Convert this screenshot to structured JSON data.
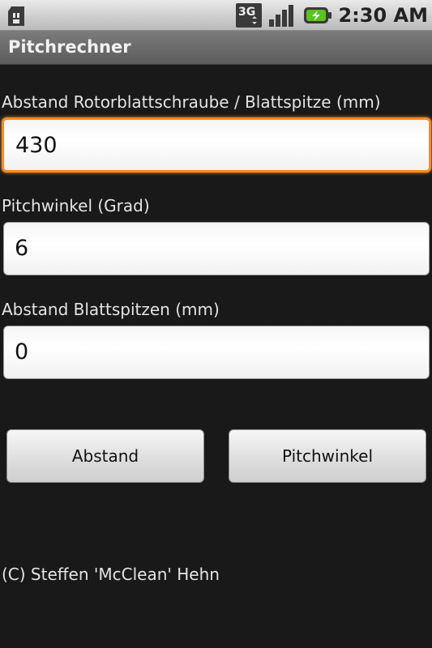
{
  "status_bar": {
    "time": "2:30 AM",
    "icons": [
      "sd-card-icon",
      "3g-data-icon",
      "signal-icon",
      "battery-charging-icon"
    ],
    "network_label": "3G"
  },
  "app": {
    "title": "Pitchrechner"
  },
  "form": {
    "fields": [
      {
        "label": "Abstand Rotorblattschraube / Blattspitze (mm)",
        "value": "430",
        "focused": true
      },
      {
        "label": "Pitchwinkel (Grad)",
        "value": "6",
        "focused": false
      },
      {
        "label": "Abstand Blattspitzen (mm)",
        "value": "0",
        "focused": false
      }
    ]
  },
  "buttons": {
    "distance_label": "Abstand",
    "pitch_label": "Pitchwinkel"
  },
  "footer": {
    "copyright": "(C) Steffen 'McClean' Hehn"
  },
  "colors": {
    "background": "#191919",
    "focus_border": "#ff8a1d",
    "title_bar": "#6b6b6b"
  }
}
